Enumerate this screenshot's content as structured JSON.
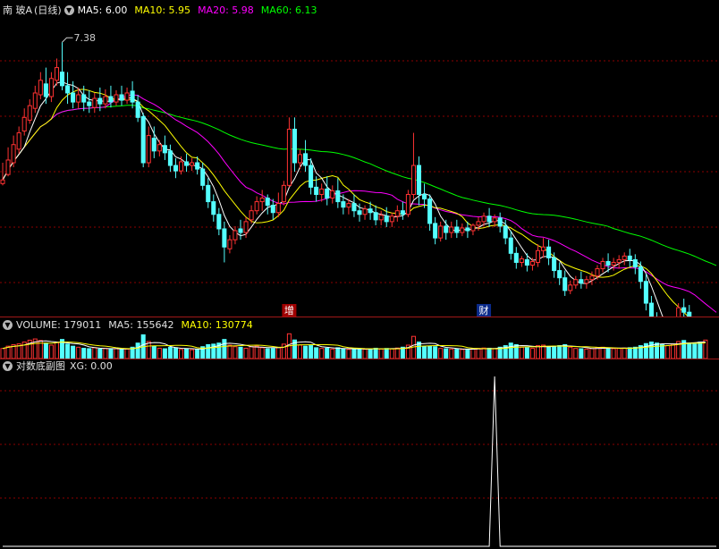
{
  "header": {
    "stock_name": "南 玻A",
    "period": "(日线)",
    "ma5_label": "MA5: 6.00",
    "ma10_label": "MA10: 5.95",
    "ma20_label": "MA20: 5.98",
    "ma60_label": "MA60: 6.13"
  },
  "volume_header": {
    "label": "VOLUME: 179011",
    "ma5_label": "MA5: 155642",
    "ma10_label": "MA10: 130774"
  },
  "indicator_header": {
    "name": "对数底副图",
    "xg_label": "XG: 0.00"
  },
  "colors": {
    "up": "#ff3232",
    "down": "#54ffff",
    "ma5": "#ffffff",
    "ma10": "#ffff00",
    "ma20": "#ff00ff",
    "ma60": "#00ff00",
    "grid": "#8b0000",
    "header_text": "#e0e0e0"
  },
  "chart_data": [
    {
      "type": "candlestick",
      "title": "南 玻A (日线)",
      "ylim": [
        4.55,
        7.55
      ],
      "high_annotation": {
        "index": 11,
        "value": 7.38,
        "label": "7.38"
      },
      "markers": [
        {
          "index": 53,
          "label": "增"
        },
        {
          "index": 89,
          "label": "财"
        }
      ],
      "ohlc": [
        [
          5.82,
          6.05,
          5.86,
          5.8
        ],
        [
          5.92,
          6.22,
          6.08,
          5.9
        ],
        [
          6.05,
          6.35,
          6.25,
          6.0
        ],
        [
          6.2,
          6.45,
          6.38,
          6.15
        ],
        [
          6.4,
          6.65,
          6.55,
          6.35
        ],
        [
          6.52,
          6.75,
          6.68,
          6.48
        ],
        [
          6.65,
          6.9,
          6.82,
          6.6
        ],
        [
          6.8,
          7.05,
          6.96,
          6.75
        ],
        [
          6.92,
          7.1,
          6.78,
          6.7
        ],
        [
          6.78,
          7.05,
          6.98,
          6.72
        ],
        [
          6.96,
          7.2,
          7.1,
          6.9
        ],
        [
          7.05,
          7.38,
          6.9,
          6.85
        ],
        [
          6.9,
          7.05,
          6.82,
          6.7
        ],
        [
          6.82,
          6.95,
          6.72,
          6.65
        ],
        [
          6.72,
          6.88,
          6.8,
          6.65
        ],
        [
          6.8,
          6.9,
          6.72,
          6.62
        ],
        [
          6.72,
          6.85,
          6.68,
          6.6
        ],
        [
          6.66,
          6.82,
          6.76,
          6.6
        ],
        [
          6.76,
          6.88,
          6.7,
          6.62
        ],
        [
          6.7,
          6.86,
          6.78,
          6.65
        ],
        [
          6.78,
          6.9,
          6.72,
          6.66
        ],
        [
          6.72,
          6.85,
          6.8,
          6.68
        ],
        [
          6.8,
          6.9,
          6.74,
          6.68
        ],
        [
          6.74,
          6.88,
          6.82,
          6.7
        ],
        [
          6.84,
          6.95,
          6.72,
          6.65
        ],
        [
          6.72,
          6.8,
          6.55,
          6.5
        ],
        [
          6.56,
          6.6,
          6.05,
          6.0
        ],
        [
          6.05,
          6.45,
          6.35,
          6.0
        ],
        [
          6.32,
          6.45,
          6.18,
          6.1
        ],
        [
          6.18,
          6.3,
          6.25,
          6.12
        ],
        [
          6.24,
          6.35,
          6.16,
          6.08
        ],
        [
          6.18,
          6.25,
          6.02,
          5.95
        ],
        [
          6.02,
          6.1,
          5.96,
          5.88
        ],
        [
          5.96,
          6.12,
          6.06,
          5.92
        ],
        [
          6.06,
          6.15,
          6.02,
          5.95
        ],
        [
          6.02,
          6.1,
          6.05,
          5.96
        ],
        [
          6.05,
          6.12,
          5.98,
          5.92
        ],
        [
          5.98,
          6.05,
          5.8,
          5.75
        ],
        [
          5.8,
          5.88,
          5.62,
          5.55
        ],
        [
          5.62,
          5.7,
          5.48,
          5.4
        ],
        [
          5.48,
          5.55,
          5.32,
          5.25
        ],
        [
          5.32,
          5.4,
          5.12,
          4.95
        ],
        [
          5.1,
          5.25,
          5.2,
          5.05
        ],
        [
          5.2,
          5.35,
          5.3,
          5.15
        ],
        [
          5.32,
          5.42,
          5.28,
          5.2
        ],
        [
          5.28,
          5.45,
          5.4,
          5.22
        ],
        [
          5.42,
          5.58,
          5.52,
          5.38
        ],
        [
          5.52,
          5.68,
          5.62,
          5.48
        ],
        [
          5.62,
          5.75,
          5.66,
          5.52
        ],
        [
          5.66,
          5.7,
          5.58,
          5.48
        ],
        [
          5.58,
          5.65,
          5.5,
          5.42
        ],
        [
          5.5,
          5.72,
          5.6,
          5.45
        ],
        [
          5.62,
          5.85,
          5.8,
          5.58
        ],
        [
          5.8,
          6.55,
          6.42,
          5.78
        ],
        [
          6.42,
          6.55,
          6.05,
          5.95
        ],
        [
          6.05,
          6.2,
          6.14,
          5.98
        ],
        [
          6.15,
          6.3,
          6.02,
          5.95
        ],
        [
          6.02,
          6.1,
          5.78,
          5.7
        ],
        [
          5.78,
          5.9,
          5.7,
          5.62
        ],
        [
          5.7,
          5.82,
          5.76,
          5.62
        ],
        [
          5.76,
          5.9,
          5.66,
          5.58
        ],
        [
          5.66,
          5.8,
          5.74,
          5.6
        ],
        [
          5.74,
          5.88,
          5.62,
          5.55
        ],
        [
          5.62,
          5.7,
          5.56,
          5.48
        ],
        [
          5.56,
          5.65,
          5.6,
          5.48
        ],
        [
          5.6,
          5.7,
          5.52,
          5.45
        ],
        [
          5.52,
          5.6,
          5.48,
          5.4
        ],
        [
          5.48,
          5.58,
          5.54,
          5.42
        ],
        [
          5.54,
          5.62,
          5.5,
          5.42
        ],
        [
          5.5,
          5.58,
          5.42,
          5.36
        ],
        [
          5.42,
          5.52,
          5.47,
          5.36
        ],
        [
          5.46,
          5.56,
          5.4,
          5.34
        ],
        [
          5.4,
          5.5,
          5.46,
          5.34
        ],
        [
          5.46,
          5.58,
          5.52,
          5.4
        ],
        [
          5.52,
          5.62,
          5.48,
          5.42
        ],
        [
          5.48,
          5.75,
          5.7,
          5.45
        ],
        [
          5.7,
          6.38,
          6.02,
          5.65
        ],
        [
          6.02,
          6.12,
          5.7,
          5.58
        ],
        [
          5.7,
          5.82,
          5.65,
          5.55
        ],
        [
          5.65,
          5.7,
          5.38,
          5.3
        ],
        [
          5.38,
          5.45,
          5.22,
          5.15
        ],
        [
          5.22,
          5.4,
          5.35,
          5.18
        ],
        [
          5.35,
          5.42,
          5.28,
          5.2
        ],
        [
          5.28,
          5.4,
          5.34,
          5.22
        ],
        [
          5.34,
          5.42,
          5.28,
          5.22
        ],
        [
          5.28,
          5.38,
          5.33,
          5.24
        ],
        [
          5.33,
          5.4,
          5.3,
          5.22
        ],
        [
          5.3,
          5.38,
          5.36,
          5.25
        ],
        [
          5.36,
          5.45,
          5.4,
          5.3
        ],
        [
          5.4,
          5.5,
          5.46,
          5.35
        ],
        [
          5.46,
          5.55,
          5.4,
          5.34
        ],
        [
          5.4,
          5.48,
          5.44,
          5.34
        ],
        [
          5.44,
          5.5,
          5.35,
          5.28
        ],
        [
          5.35,
          5.42,
          5.22,
          5.15
        ],
        [
          5.22,
          5.3,
          5.05,
          4.98
        ],
        [
          5.05,
          5.12,
          4.95,
          4.88
        ],
        [
          4.95,
          5.02,
          4.99,
          4.9
        ],
        [
          4.98,
          5.05,
          4.92,
          4.85
        ],
        [
          4.92,
          5.0,
          4.96,
          4.86
        ],
        [
          4.95,
          5.15,
          5.08,
          4.9
        ],
        [
          5.08,
          5.22,
          5.12,
          5.0
        ],
        [
          5.12,
          5.2,
          5.0,
          4.92
        ],
        [
          5.0,
          5.06,
          4.86,
          4.78
        ],
        [
          4.86,
          4.95,
          4.78,
          4.7
        ],
        [
          4.78,
          4.86,
          4.64,
          4.58
        ],
        [
          4.64,
          4.75,
          4.7,
          4.6
        ],
        [
          4.7,
          4.8,
          4.76,
          4.66
        ],
        [
          4.76,
          4.85,
          4.72,
          4.66
        ],
        [
          4.72,
          4.8,
          4.76,
          4.66
        ],
        [
          4.76,
          4.85,
          4.8,
          4.7
        ],
        [
          4.8,
          4.92,
          4.88,
          4.76
        ],
        [
          4.88,
          5.0,
          4.96,
          4.84
        ],
        [
          4.96,
          5.05,
          4.92,
          4.84
        ],
        [
          4.92,
          5.0,
          4.95,
          4.86
        ],
        [
          4.95,
          5.03,
          4.98,
          4.88
        ],
        [
          4.98,
          5.06,
          5.02,
          4.92
        ],
        [
          5.02,
          5.1,
          4.98,
          4.9
        ],
        [
          4.98,
          5.04,
          4.9,
          4.82
        ],
        [
          4.9,
          4.96,
          4.74,
          4.66
        ],
        [
          4.74,
          4.82,
          4.5,
          4.42
        ],
        [
          4.5,
          4.58,
          4.32,
          4.25
        ],
        [
          4.32,
          4.4,
          4.18,
          4.1
        ],
        [
          4.18,
          4.26,
          4.08,
          4.0
        ],
        [
          4.08,
          4.2,
          4.15,
          4.02
        ],
        [
          4.15,
          4.32,
          4.28,
          4.1
        ],
        [
          4.28,
          4.5,
          4.45,
          4.22
        ],
        [
          4.45,
          4.55,
          4.4,
          4.35
        ],
        [
          4.4,
          4.48,
          4.28,
          4.2
        ],
        [
          4.28,
          4.35,
          4.05,
          3.98
        ],
        [
          4.05,
          4.1,
          3.82,
          3.75
        ],
        [
          3.82,
          3.95,
          3.9,
          3.72
        ],
        [
          3.9,
          4.05,
          4.02,
          3.85
        ],
        [
          4.02,
          4.12,
          3.96,
          3.88
        ]
      ]
    },
    {
      "type": "bar",
      "title": "VOLUME",
      "ylim": [
        0,
        260000
      ],
      "values": [
        98000,
        120000,
        135000,
        142000,
        160000,
        178000,
        190000,
        175000,
        150000,
        130000,
        155000,
        185000,
        140000,
        120000,
        110000,
        100000,
        96000,
        105000,
        92000,
        98000,
        90000,
        95000,
        88000,
        92000,
        110000,
        150000,
        230000,
        165000,
        120000,
        100000,
        95000,
        110000,
        105000,
        88000,
        92000,
        85000,
        90000,
        115000,
        135000,
        140000,
        150000,
        185000,
        130000,
        115000,
        110000,
        100000,
        115000,
        120000,
        105000,
        95000,
        98000,
        108000,
        140000,
        240000,
        180000,
        130000,
        120000,
        125000,
        105000,
        98000,
        100000,
        92000,
        105000,
        95000,
        88000,
        92000,
        96000,
        90000,
        95000,
        100000,
        92000,
        98000,
        94000,
        102000,
        110000,
        130000,
        215000,
        160000,
        115000,
        120000,
        115000,
        98000,
        95000,
        92000,
        90000,
        88000,
        92000,
        95000,
        98000,
        102000,
        100000,
        96000,
        110000,
        125000,
        150000,
        135000,
        110000,
        105000,
        100000,
        125000,
        130000,
        115000,
        120000,
        125000,
        135000,
        110000,
        98000,
        95000,
        92000,
        96000,
        105000,
        110000,
        100000,
        96000,
        98000,
        102000,
        105000,
        110000,
        125000,
        145000,
        160000,
        150000,
        135000,
        125000,
        140000,
        165000,
        175000,
        150000,
        140000,
        160000,
        179011
      ]
    },
    {
      "type": "line",
      "title": "对数底副图",
      "series": [
        {
          "name": "XG",
          "peak_index": 91,
          "peak_value": 1,
          "baseline": 0
        }
      ]
    }
  ]
}
